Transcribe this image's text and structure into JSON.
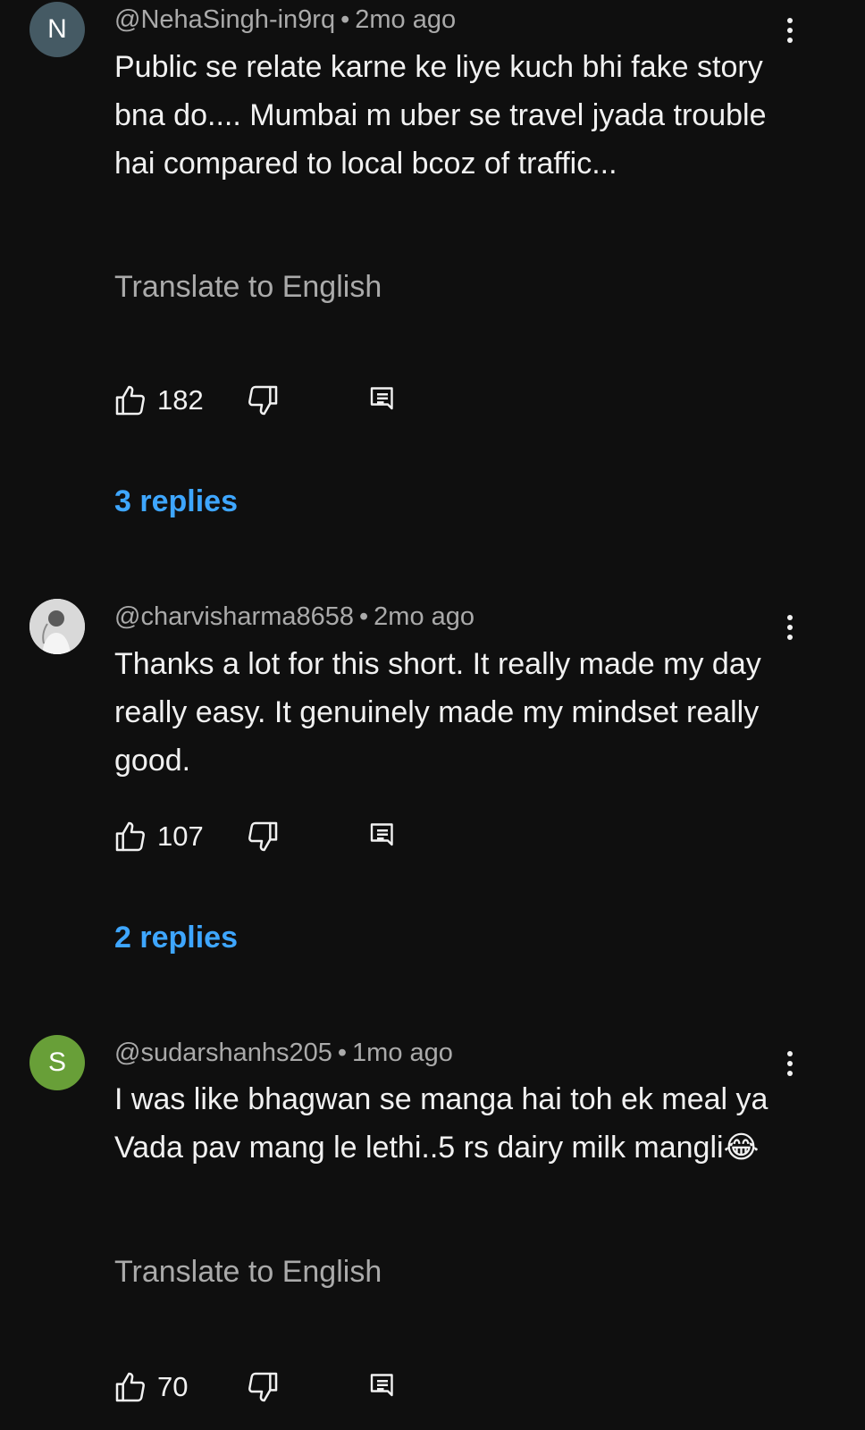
{
  "comments": [
    {
      "avatar_letter": "N",
      "avatar_color": "#455a64",
      "handle": "@NehaSingh-in9rq",
      "separator": "•",
      "time": "2mo ago",
      "text": "Public se relate karne ke liye kuch bhi fake story bna do.... Mumbai m uber se travel jyada trouble hai compared to local bcoz of traffic...",
      "translate_label": "Translate to English",
      "likes": "182",
      "replies_label": "3 replies"
    },
    {
      "avatar_letter": "",
      "avatar_color": "#e0e0e0",
      "handle": "@charvisharma8658",
      "separator": "•",
      "time": "2mo ago",
      "text": "Thanks a lot for this short. It really made my day really easy. It genuinely made my mindset really good.",
      "likes": "107",
      "replies_label": "2 replies"
    },
    {
      "avatar_letter": "S",
      "avatar_color": "#689f38",
      "handle": "@sudarshanhs205",
      "separator": "•",
      "time": "1mo ago",
      "text": "I was like bhagwan se manga hai toh ek meal ya Vada pav mang le lethi..5 rs dairy milk mangli",
      "text_emoji": "😂",
      "translate_label": "Translate to English",
      "likes": "70"
    }
  ],
  "icons": {
    "like": "thumbs-up-icon",
    "dislike": "thumbs-down-icon",
    "reply": "reply-comment-icon",
    "menu": "more-vertical-icon"
  },
  "colors": {
    "background": "#0f0f0f",
    "text": "#f1f1f1",
    "muted": "#aaaaaa",
    "link": "#3ea6ff"
  }
}
